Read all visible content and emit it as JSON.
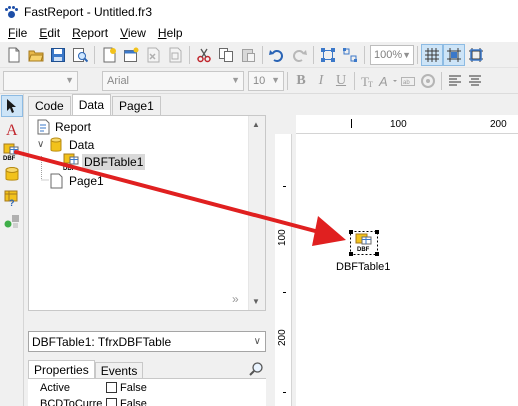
{
  "window": {
    "title": "FastReport - Untitled.fr3"
  },
  "menu": [
    {
      "label": "File",
      "u": "F",
      "rest": "ile"
    },
    {
      "label": "Edit",
      "u": "E",
      "rest": "dit"
    },
    {
      "label": "Report",
      "u": "R",
      "rest": "eport"
    },
    {
      "label": "View",
      "u": "V",
      "rest": "iew"
    },
    {
      "label": "Help",
      "u": "H",
      "rest": "elp"
    }
  ],
  "toolbar": {
    "zoom": "100%"
  },
  "format_toolbar": {
    "font_name": "Arial",
    "font_size": "10"
  },
  "tabs": {
    "code": "Code",
    "data": "Data",
    "page1": "Page1"
  },
  "tree": {
    "report": "Report",
    "data": "Data",
    "dbftable": "DBFTable1",
    "page1": "Page1"
  },
  "object_selector": {
    "value": "DBFTable1: TfrxDBFTable"
  },
  "inspector": {
    "tab_properties": "Properties",
    "tab_events": "Events",
    "rows": [
      {
        "name": "Active",
        "value": "False"
      },
      {
        "name": "BCDToCurrer",
        "value": "False"
      }
    ]
  },
  "rulers": {
    "h": [
      "100",
      "200"
    ],
    "v": [
      "100",
      "200"
    ]
  },
  "canvas": {
    "component_label": "DBFTable1",
    "component_icon_text": "DBF"
  },
  "colors": {
    "arrow": "#e02020",
    "selection_bg": "#d9d9d9",
    "db_yellow": "#f2c21b"
  }
}
